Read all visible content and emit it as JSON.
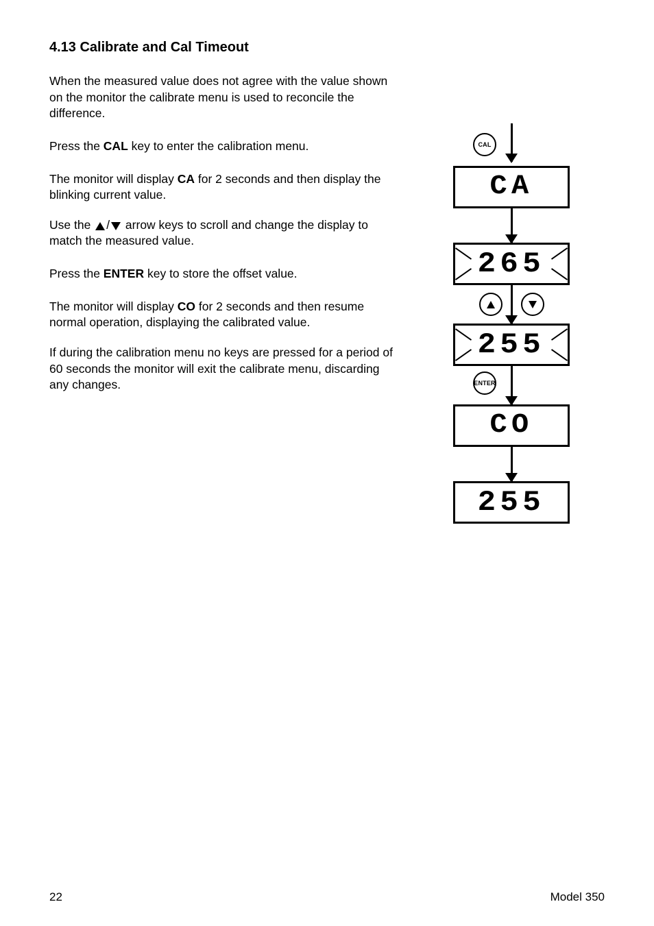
{
  "section": {
    "title": "4.13 Calibrate and Cal Timeout"
  },
  "paragraphs": {
    "intro": "When the measured value does not agree with the value shown on the monitor the calibrate menu is used to reconcile the difference.",
    "enter_cal": {
      "prefix": "Press the ",
      "cal_bold": "CAL",
      "suffix": " key to enter the calibration menu."
    },
    "display_ca": {
      "part1": "The monitor will display ",
      "ca_bold": "CA",
      "part2": " for 2 seconds and then display the blinking current value."
    },
    "arrows": {
      "part1": "Use the ",
      "mid": "/",
      "part2": " arrow keys to scroll and change the display to match the measured value."
    },
    "enter": {
      "part1": "Press the ",
      "enter_bold": "ENTER",
      "part2": " key to store the offset value."
    },
    "display_co": {
      "part1": "The monitor will display ",
      "co_bold": "CO",
      "part2": " for 2 seconds and then resume normal operation, displaying the calibrated value."
    },
    "timeout": "If during the calibration menu no keys are pressed for a period of 60 seconds the monitor will exit the calibrate menu, discarding any changes."
  },
  "diagram": {
    "cal_button": "CAL",
    "ca_display": "CA",
    "value_before": "265",
    "value_after": "255",
    "enter_button": "ENTER",
    "co_display": "CO",
    "final_display": "255"
  },
  "footer": {
    "page": "22",
    "model": "Model 350"
  }
}
